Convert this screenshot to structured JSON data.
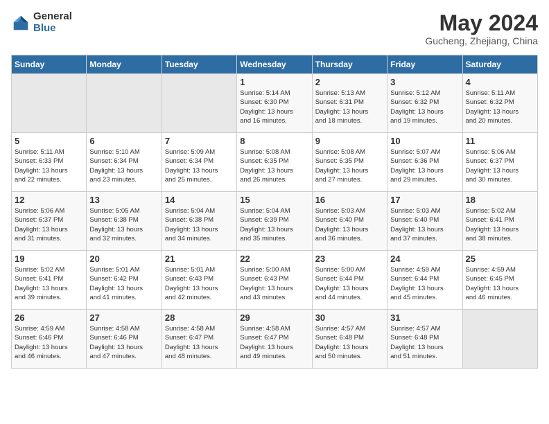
{
  "logo": {
    "general": "General",
    "blue": "Blue"
  },
  "title": "May 2024",
  "subtitle": "Gucheng, Zhejiang, China",
  "weekdays": [
    "Sunday",
    "Monday",
    "Tuesday",
    "Wednesday",
    "Thursday",
    "Friday",
    "Saturday"
  ],
  "weeks": [
    [
      {
        "day": "",
        "info": ""
      },
      {
        "day": "",
        "info": ""
      },
      {
        "day": "",
        "info": ""
      },
      {
        "day": "1",
        "info": "Sunrise: 5:14 AM\nSunset: 6:30 PM\nDaylight: 13 hours\nand 16 minutes."
      },
      {
        "day": "2",
        "info": "Sunrise: 5:13 AM\nSunset: 6:31 PM\nDaylight: 13 hours\nand 18 minutes."
      },
      {
        "day": "3",
        "info": "Sunrise: 5:12 AM\nSunset: 6:32 PM\nDaylight: 13 hours\nand 19 minutes."
      },
      {
        "day": "4",
        "info": "Sunrise: 5:11 AM\nSunset: 6:32 PM\nDaylight: 13 hours\nand 20 minutes."
      }
    ],
    [
      {
        "day": "5",
        "info": "Sunrise: 5:11 AM\nSunset: 6:33 PM\nDaylight: 13 hours\nand 22 minutes."
      },
      {
        "day": "6",
        "info": "Sunrise: 5:10 AM\nSunset: 6:34 PM\nDaylight: 13 hours\nand 23 minutes."
      },
      {
        "day": "7",
        "info": "Sunrise: 5:09 AM\nSunset: 6:34 PM\nDaylight: 13 hours\nand 25 minutes."
      },
      {
        "day": "8",
        "info": "Sunrise: 5:08 AM\nSunset: 6:35 PM\nDaylight: 13 hours\nand 26 minutes."
      },
      {
        "day": "9",
        "info": "Sunrise: 5:08 AM\nSunset: 6:35 PM\nDaylight: 13 hours\nand 27 minutes."
      },
      {
        "day": "10",
        "info": "Sunrise: 5:07 AM\nSunset: 6:36 PM\nDaylight: 13 hours\nand 29 minutes."
      },
      {
        "day": "11",
        "info": "Sunrise: 5:06 AM\nSunset: 6:37 PM\nDaylight: 13 hours\nand 30 minutes."
      }
    ],
    [
      {
        "day": "12",
        "info": "Sunrise: 5:06 AM\nSunset: 6:37 PM\nDaylight: 13 hours\nand 31 minutes."
      },
      {
        "day": "13",
        "info": "Sunrise: 5:05 AM\nSunset: 6:38 PM\nDaylight: 13 hours\nand 32 minutes."
      },
      {
        "day": "14",
        "info": "Sunrise: 5:04 AM\nSunset: 6:38 PM\nDaylight: 13 hours\nand 34 minutes."
      },
      {
        "day": "15",
        "info": "Sunrise: 5:04 AM\nSunset: 6:39 PM\nDaylight: 13 hours\nand 35 minutes."
      },
      {
        "day": "16",
        "info": "Sunrise: 5:03 AM\nSunset: 6:40 PM\nDaylight: 13 hours\nand 36 minutes."
      },
      {
        "day": "17",
        "info": "Sunrise: 5:03 AM\nSunset: 6:40 PM\nDaylight: 13 hours\nand 37 minutes."
      },
      {
        "day": "18",
        "info": "Sunrise: 5:02 AM\nSunset: 6:41 PM\nDaylight: 13 hours\nand 38 minutes."
      }
    ],
    [
      {
        "day": "19",
        "info": "Sunrise: 5:02 AM\nSunset: 6:41 PM\nDaylight: 13 hours\nand 39 minutes."
      },
      {
        "day": "20",
        "info": "Sunrise: 5:01 AM\nSunset: 6:42 PM\nDaylight: 13 hours\nand 41 minutes."
      },
      {
        "day": "21",
        "info": "Sunrise: 5:01 AM\nSunset: 6:43 PM\nDaylight: 13 hours\nand 42 minutes."
      },
      {
        "day": "22",
        "info": "Sunrise: 5:00 AM\nSunset: 6:43 PM\nDaylight: 13 hours\nand 43 minutes."
      },
      {
        "day": "23",
        "info": "Sunrise: 5:00 AM\nSunset: 6:44 PM\nDaylight: 13 hours\nand 44 minutes."
      },
      {
        "day": "24",
        "info": "Sunrise: 4:59 AM\nSunset: 6:44 PM\nDaylight: 13 hours\nand 45 minutes."
      },
      {
        "day": "25",
        "info": "Sunrise: 4:59 AM\nSunset: 6:45 PM\nDaylight: 13 hours\nand 46 minutes."
      }
    ],
    [
      {
        "day": "26",
        "info": "Sunrise: 4:59 AM\nSunset: 6:46 PM\nDaylight: 13 hours\nand 46 minutes."
      },
      {
        "day": "27",
        "info": "Sunrise: 4:58 AM\nSunset: 6:46 PM\nDaylight: 13 hours\nand 47 minutes."
      },
      {
        "day": "28",
        "info": "Sunrise: 4:58 AM\nSunset: 6:47 PM\nDaylight: 13 hours\nand 48 minutes."
      },
      {
        "day": "29",
        "info": "Sunrise: 4:58 AM\nSunset: 6:47 PM\nDaylight: 13 hours\nand 49 minutes."
      },
      {
        "day": "30",
        "info": "Sunrise: 4:57 AM\nSunset: 6:48 PM\nDaylight: 13 hours\nand 50 minutes."
      },
      {
        "day": "31",
        "info": "Sunrise: 4:57 AM\nSunset: 6:48 PM\nDaylight: 13 hours\nand 51 minutes."
      },
      {
        "day": "",
        "info": ""
      }
    ]
  ]
}
